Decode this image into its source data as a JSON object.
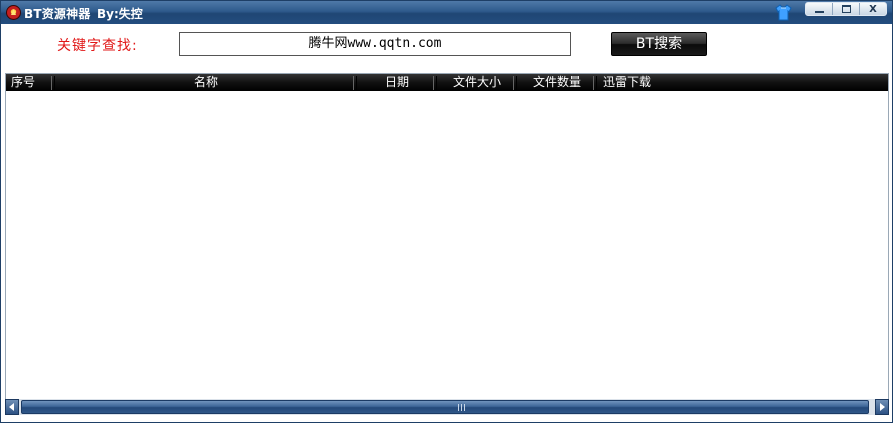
{
  "window": {
    "title": "BT资源神器",
    "author": "By:失控",
    "buttons": {
      "minimize": "minimize",
      "maximize": "maximize",
      "close": "X"
    }
  },
  "search": {
    "label": "关键字查找:",
    "value": "腾牛网www.qqtn.com",
    "button_label": "BT搜索"
  },
  "table": {
    "columns": [
      "序号",
      "名称",
      "日期",
      "文件大小",
      "文件数量",
      "迅雷下载"
    ],
    "rows": []
  },
  "icons": [
    "app-logo-icon",
    "skin-shirt-icon",
    "minimize-icon",
    "maximize-icon",
    "close-icon",
    "scroll-left-icon",
    "scroll-right-icon"
  ],
  "colors": {
    "titlebar": "#2e5a8c",
    "label_red": "#e11818",
    "header_black": "#111111",
    "scroll_thumb": "#3e6698"
  }
}
